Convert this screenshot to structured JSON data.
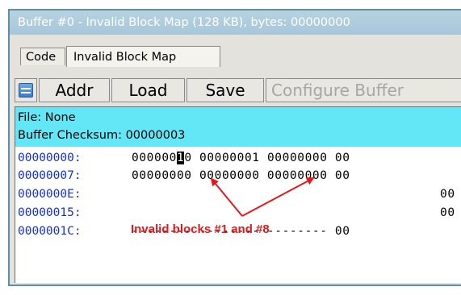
{
  "window": {
    "title": "Buffer #0 - Invalid Block Map (128 KB), bytes: 00000000"
  },
  "tabs": [
    {
      "label": "Code"
    },
    {
      "label": "Invalid Block Map"
    }
  ],
  "toolbar": {
    "icon": "grid-icon",
    "buttons": [
      {
        "label": "Addr"
      },
      {
        "label": "Load"
      },
      {
        "label": "Save"
      },
      {
        "label": "Configure Buffer"
      }
    ]
  },
  "info": {
    "file": "File: None",
    "checksum": "Buffer Checksum: 00000003"
  },
  "rows": [
    {
      "addr": "00000000:",
      "pre": "000000",
      "cursor": "1",
      "post": "0 00000001 00000000 00"
    },
    {
      "addr": "00000007:",
      "pre": "00000000 00000000 00000000 00",
      "cursor": "",
      "post": ""
    },
    {
      "addr": "0000000E:",
      "pre": "",
      "cursor": "",
      "post": "00"
    },
    {
      "addr": "00000015:",
      "pre": "",
      "cursor": "",
      "post": "00"
    },
    {
      "addr": "0000001C:",
      "pre": "-------- -------- -------- 00",
      "cursor": "",
      "post": ""
    }
  ],
  "annotation": {
    "text": "Invalid blocks #1 and #8",
    "color": "#e31a1c"
  },
  "colors": {
    "title_bar": "#a7c6d7",
    "info_bg": "#63e7f6",
    "address_text": "#1430d6",
    "tab_underline": "#e3191d"
  }
}
